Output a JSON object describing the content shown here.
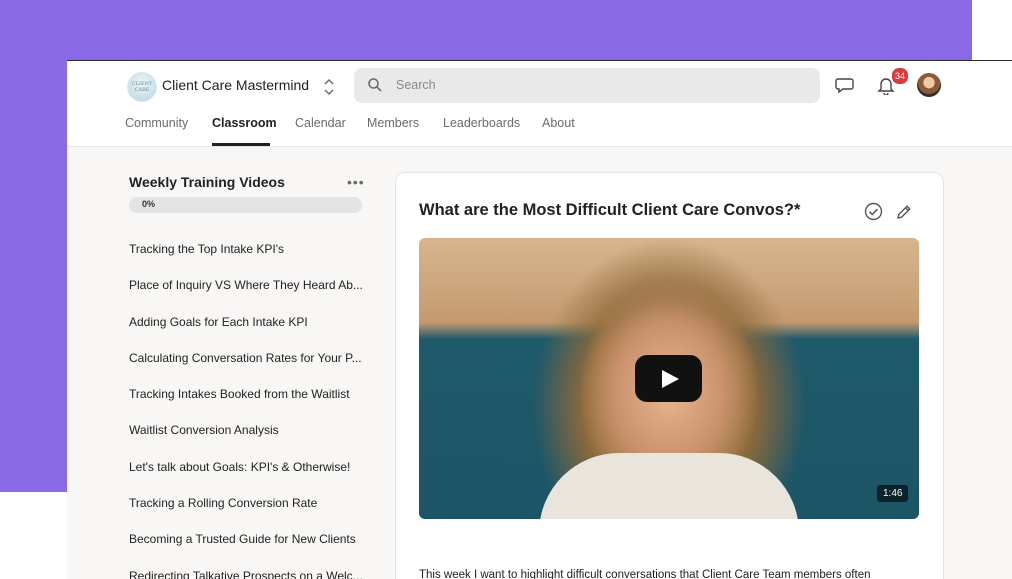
{
  "app": {
    "name": "Client Care Mastermind",
    "logo_text": "CLIENT CARE"
  },
  "search": {
    "placeholder": "Search"
  },
  "notifications": {
    "count": "34"
  },
  "nav": {
    "tabs": [
      "Community",
      "Classroom",
      "Calendar",
      "Members",
      "Leaderboards",
      "About"
    ],
    "active": "Classroom"
  },
  "course": {
    "title": "Weekly Training Videos",
    "more_label": "•••",
    "progress_label": "0%",
    "progress_fraction": 0,
    "lessons": [
      "Tracking the Top Intake KPI's",
      "Place of Inquiry VS Where They Heard Ab...",
      "Adding Goals for Each Intake KPI",
      "Calculating Conversation Rates for Your P...",
      "Tracking Intakes Booked from the Waitlist",
      "Waitlist Conversion Analysis",
      "Let's talk about Goals: KPI's & Otherwise!",
      "Tracking a Rolling Conversion Rate",
      "Becoming a Trusted Guide for New Clients",
      "Redirecting Talkative Prospects on a Welc..."
    ]
  },
  "lesson": {
    "title": "What are the Most Difficult Client Care Convos?*",
    "video_duration": "1:46",
    "description": "This week I want to highlight difficult conversations that Client Care Team members often"
  },
  "colors": {
    "background_accent": "#8a69e6",
    "badge": "#d93a3a"
  }
}
